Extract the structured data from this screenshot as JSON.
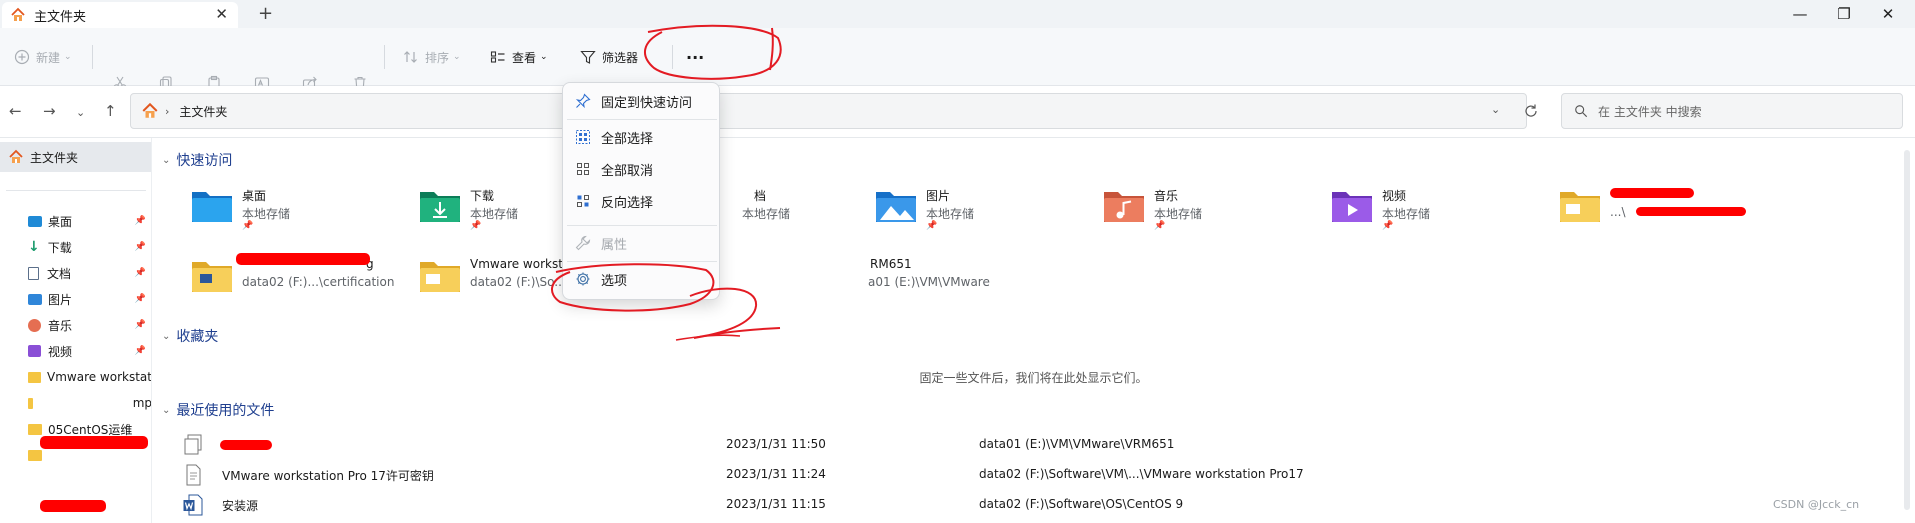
{
  "tab": {
    "title": "主文件夹",
    "close": "✕",
    "new": "+"
  },
  "window": {
    "minimize": "—",
    "maximize": "❐",
    "close": "✕"
  },
  "toolbar": {
    "new": "新建",
    "sort": "排序",
    "view": "查看",
    "filter": "筛选器",
    "more": "···"
  },
  "address": {
    "path": "主文件夹",
    "search_placeholder": "在 主文件夹 中搜索"
  },
  "sidebar": {
    "home": "主文件夹",
    "items": [
      {
        "label": "桌面",
        "pinned": true
      },
      {
        "label": "下载",
        "pinned": true
      },
      {
        "label": "文档",
        "pinned": true
      },
      {
        "label": "图片",
        "pinned": true
      },
      {
        "label": "音乐",
        "pinned": true
      },
      {
        "label": "视频",
        "pinned": true
      },
      {
        "label": "Vmware workstat",
        "pinned": false
      },
      {
        "label": "mp",
        "pinned": false
      },
      {
        "label": "05CentOS运维",
        "pinned": false
      },
      {
        "label": "",
        "pinned": false
      }
    ]
  },
  "quick_access": {
    "heading": "快速访问",
    "row1": [
      {
        "name": "桌面",
        "sub": "本地存储"
      },
      {
        "name": "下载",
        "sub": "本地存储"
      },
      {
        "name": "档",
        "sub": "本地存储"
      },
      {
        "name": "图片",
        "sub": "本地存储"
      },
      {
        "name": "音乐",
        "sub": "本地存储"
      },
      {
        "name": "视频",
        "sub": "本地存储"
      },
      {
        "name": "",
        "sub": "...\\"
      }
    ],
    "row2": [
      {
        "name": "g",
        "sub": "data02 (F:)...\\certification"
      },
      {
        "name": "Vmware workstat",
        "sub": "data02 (F:)\\So..."
      },
      {
        "name": "RM651",
        "sub": "a01 (E:)\\VM\\VMware"
      }
    ],
    "pin_glyph": "📌"
  },
  "favorites": {
    "heading": "收藏夹",
    "empty": "固定一些文件后，我们将在此处显示它们。"
  },
  "recent": {
    "heading": "最近使用的文件",
    "rows": [
      {
        "name": "",
        "date": "2023/1/31 11:50",
        "path": "data01 (E:)\\VM\\VMware\\VRM651"
      },
      {
        "name": "VMware workstation Pro 17许可密钥",
        "date": "2023/1/31 11:24",
        "path": "data02 (F:)\\Software\\VM\\...\\VMware workstation Pro17"
      },
      {
        "name": "安装源",
        "date": "2023/1/31 11:15",
        "path": "data02 (F:)\\Software\\OS\\CentOS 9"
      }
    ]
  },
  "menu": {
    "pin_quick": "固定到快速访问",
    "select_all": "全部选择",
    "select_none": "全部取消",
    "invert": "反向选择",
    "properties": "属性",
    "options": "选项"
  },
  "watermark": "CSDN @Jcck_cn",
  "colors": {
    "accent": "#1f3f8f",
    "folder": "#f4c542",
    "annotation": "#e31b23"
  },
  "icons": {
    "home": "home-icon",
    "pin": "pin-icon",
    "gear": "gear-icon",
    "filter": "filter-icon",
    "search": "search-icon"
  }
}
